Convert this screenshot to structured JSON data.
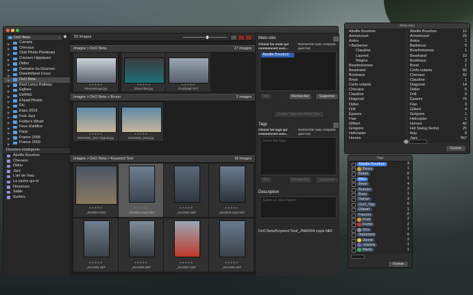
{
  "app": {
    "title": "DxO Beta",
    "image_count": "53 images"
  },
  "sidebar": {
    "folders": [
      {
        "label": "Carnets",
        "expanded": false
      },
      {
        "label": "Chevaux",
        "expanded": false
      },
      {
        "label": "Club Photo Plestinais",
        "expanded": false
      },
      {
        "label": "Courses Hippiques",
        "expanded": false
      },
      {
        "label": "Didier",
        "expanded": false
      },
      {
        "label": "Domaine du Dourven",
        "expanded": false
      },
      {
        "label": "Downhilland Cross",
        "expanded": false
      },
      {
        "label": "DxO Beta",
        "expanded": false,
        "selected": true
      },
      {
        "label": "East Lancs Railway",
        "expanded": false
      },
      {
        "label": "Églises",
        "expanded": false
      },
      {
        "label": "EHPAD",
        "expanded": false
      },
      {
        "label": "Ehpad Plestin",
        "expanded": false
      },
      {
        "label": "Etc",
        "expanded": false
      },
      {
        "label": "Expo 2018",
        "expanded": false
      },
      {
        "label": "Fest Jazz",
        "expanded": false
      },
      {
        "label": "Fettler's Wharf",
        "expanded": false
      },
      {
        "label": "Feux d'artifice",
        "expanded": false
      },
      {
        "label": "Flickr",
        "expanded": false
      },
      {
        "label": "France 2008",
        "expanded": false
      },
      {
        "label": "France 2009",
        "expanded": false
      }
    ],
    "smart_title": "Dossiers intelligents",
    "smart_folders": [
      "Abeille Bourbon",
      "Chevaux",
      "Didier",
      "Jazz",
      "L'art de l'eau",
      "La vache qui rit",
      "Nounours",
      "Sable",
      "Surfers"
    ]
  },
  "groups": [
    {
      "title": "Images > DxO Beta",
      "count": "27 images",
      "thumbs": [
        {
          "name": "PreviewImage.jpg",
          "stars": "★★★★★"
        },
        {
          "name": "Dirax-Filter.jpg",
          "stars": "★★★★★"
        },
        {
          "name": "Thumbnail.TIFF",
          "stars": "★★★★★"
        }
      ]
    },
    {
      "title": "Images > DxO Beta > Bruno",
      "count": "2 images",
      "thumbs": [
        {
          "name": "IMG00081_DxO Original.jpg",
          "stars": "★★★★★"
        },
        {
          "name": "IMG00081_DxO.jpg",
          "stars": "★★★★★"
        }
      ]
    },
    {
      "title": "Images > DxO Beta > Keyword Test",
      "count": "18 images",
      "thumbs": [
        {
          "name": "_JN00004.RW2",
          "stars": "★★★★★"
        },
        {
          "name": "_JNA0004 copie.NEF",
          "stars": "★★★★★"
        },
        {
          "name": "_JNA0004.NEF",
          "stars": "★★★★★"
        },
        {
          "name": "_JNA0005 copie.NEF",
          "stars": "★★★★★"
        },
        {
          "name": "_JNA0005.NEF",
          "stars": "★★★★★"
        },
        {
          "name": "_JNA0006.NEF",
          "stars": "★★★★★"
        },
        {
          "name": "_JNA0007.NEF",
          "stars": "★★★★★"
        },
        {
          "name": "_JNA0008.NEF",
          "stars": "★★★★★"
        }
      ]
    }
  ],
  "keywords_panel": {
    "title": "Mots-clés",
    "choose_label": "Choisir les mots qui commencent avec...",
    "search_label": "Rechercher avec n'importe quel mot",
    "selected_keyword": "Abeille Bourbon",
    "buttons": {
      "add": "Nlle",
      "search": "Rechercher",
      "delete": "Supprimer",
      "copy": "Copier Tags vers Mots-Clés"
    }
  },
  "tags_panel": {
    "title": "Tags",
    "choose_label": "Choisir les tags qui commencent avec...",
    "search_label": "Rechercher avec n'importe quel mot",
    "placeholder": "Saisir les tags",
    "buttons": {
      "add": "Nlle",
      "search": "Rechercher",
      "delete": "Supprimer"
    }
  },
  "description_panel": {
    "title": "Description",
    "placeholder": "Saisir un description",
    "path": "DxO Beta/Keyword Test/_JNA0004 copie.NEF"
  },
  "keywords_palette": {
    "title": "Mots-clés",
    "left": [
      "Abeille Bourbon",
      "Armoricourt",
      "Autos",
      "Barbecue",
      "Claudine",
      "Laurent",
      "Régine",
      "Bearthelomew",
      "Beartrand",
      "Bordeaux",
      "Brest",
      "Cerfs-volants",
      "Chevaux",
      "Claudine",
      "Diagonal",
      "Didier",
      "Drill",
      "Épaves",
      "Flan",
      "Gilbert",
      "Grégoire",
      "Helicopter",
      "Horses"
    ],
    "right": [
      {
        "label": "Abeille Bourbon",
        "count": "12"
      },
      {
        "label": "Armoricourt",
        "count": "25"
      },
      {
        "label": "Autos",
        "count": "1"
      },
      {
        "label": "Barbecue",
        "count": "5"
      },
      {
        "label": "Bearthelomew",
        "count": "1"
      },
      {
        "label": "Beartrand",
        "count": "10"
      },
      {
        "label": "Bordeaux",
        "count": "2"
      },
      {
        "label": "Brest",
        "count": "1"
      },
      {
        "label": "Cerfs-volants",
        "count": "60"
      },
      {
        "label": "Chevaux",
        "count": "42"
      },
      {
        "label": "Claudine",
        "count": "1"
      },
      {
        "label": "Diagonal",
        "count": "14"
      },
      {
        "label": "Didier",
        "count": "5"
      },
      {
        "label": "Drill",
        "count": "0"
      },
      {
        "label": "Épaves",
        "count": "70"
      },
      {
        "label": "Flan",
        "count": "3"
      },
      {
        "label": "Gilbert",
        "count": "4"
      },
      {
        "label": "Grégoire",
        "count": "1"
      },
      {
        "label": "Helicopter",
        "count": "1"
      },
      {
        "label": "Horses",
        "count": "42"
      },
      {
        "label": "Hot Swing Sextet",
        "count": "25"
      },
      {
        "label": "Ikay",
        "count": "0"
      },
      {
        "label": "Jazz",
        "count": "567"
      }
    ],
    "close_button": "Fermer"
  },
  "tags_palette": {
    "title": "Tags",
    "items": [
      {
        "label": "Abeille Bourbon",
        "count": "3",
        "color": "#3d7be0"
      },
      {
        "label": "Bears",
        "count": "1",
        "color": "#e0a11e"
      },
      {
        "label": "Bebel",
        "count": "0",
        "color": ""
      },
      {
        "label": "Bleu",
        "count": "1",
        "color": "#3d7be0"
      },
      {
        "label": "Brest",
        "count": "4",
        "color": ""
      },
      {
        "label": "Bureau",
        "count": "2",
        "color": ""
      },
      {
        "label": "Buzz",
        "count": "1",
        "color": ""
      },
      {
        "label": "Danse",
        "count": "3",
        "color": ""
      },
      {
        "label": "DxO_Tag",
        "count": "0",
        "color": ""
      },
      {
        "label": "Départ",
        "count": "1",
        "color": ""
      },
      {
        "label": "Faucon",
        "count": "0",
        "color": ""
      },
      {
        "label": "Fred",
        "count": "2",
        "color": "#e0a11e"
      },
      {
        "label": "Furtie",
        "count": "2",
        "color": "#c0392b"
      },
      {
        "label": "Gris",
        "count": "1",
        "color": "#8e8e8e"
      },
      {
        "label": "Important",
        "count": "0",
        "color": ""
      },
      {
        "label": "Jaune",
        "count": "2",
        "color": "#e6cf2b"
      },
      {
        "label": "Joanna",
        "count": "1",
        "color": "#7e57c2"
      },
      {
        "label": "Marie",
        "count": "1",
        "color": "#3aaa55"
      }
    ],
    "close_button": "Fermer"
  }
}
